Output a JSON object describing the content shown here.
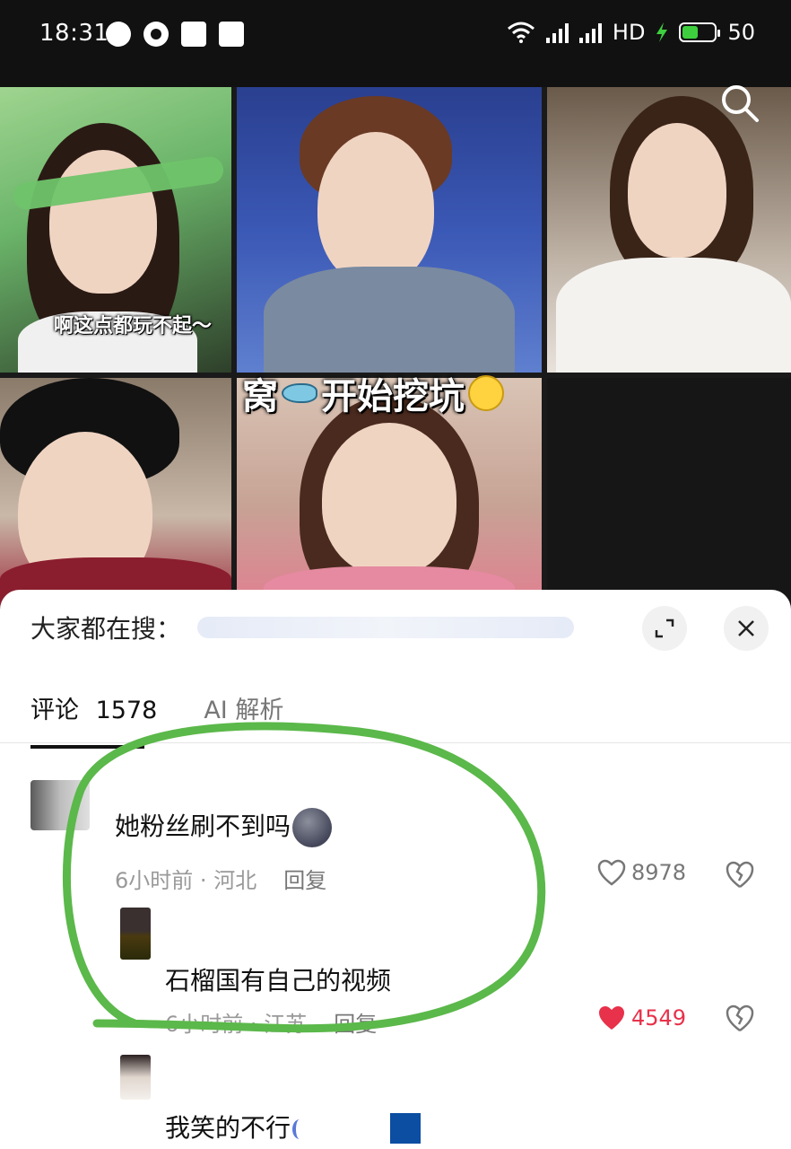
{
  "status_bar": {
    "time": "18:31",
    "network": "HD",
    "battery": "50",
    "battery_level": 0.5
  },
  "video": {
    "caption_small": "啊这点都玩不起～",
    "caption_big_a": "窝",
    "caption_big_b": "开始挖坑"
  },
  "panel": {
    "search_label": "大家都在搜：",
    "tabs": [
      {
        "label": "评论",
        "count": "1578"
      },
      {
        "label": "AI 解析"
      }
    ]
  },
  "comments": [
    {
      "text": "她粉丝刷不到吗",
      "meta_time": "6小时前",
      "meta_sep": "·",
      "meta_location": "河北",
      "reply": "回复",
      "likes": "8978",
      "liked": false
    },
    {
      "text": "石榴国有自己的视频",
      "meta_time": "6小时前",
      "meta_sep": "·",
      "meta_location": "江苏",
      "reply": "回复",
      "likes": "4549",
      "liked": true
    },
    {
      "text": "我笑的不行"
    }
  ],
  "colors": {
    "accent_like": "#e8314a",
    "annotation_green": "#5bb84a"
  }
}
